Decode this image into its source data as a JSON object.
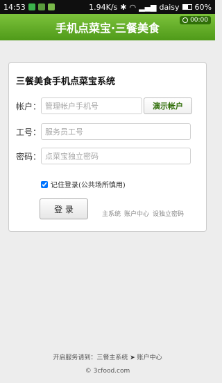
{
  "status_bar": {
    "time": "14:53",
    "speed": "1.94K/s",
    "carrier": "daisy",
    "battery": "60%",
    "battery_level": 0.6
  },
  "header": {
    "title": "手机点菜宝·三餐美食",
    "timer": "00:00"
  },
  "login": {
    "title": "三餐美食手机点菜宝系统",
    "account_label": "帐户：",
    "account_placeholder": "管理帐户手机号",
    "demo_button": "演示帐户",
    "staff_label": "工号：",
    "staff_placeholder": "服务员工号",
    "password_label": "密码：",
    "password_placeholder": "点菜宝独立密码",
    "remember_label": "记住登录(公共场所慎用)",
    "remember_checked": true,
    "login_button": "登 录",
    "links": [
      "主系统",
      "账户中心",
      "设独立密码"
    ]
  },
  "footer": {
    "service_prefix": "开启服务请到：三餐主系统",
    "arrow": "➤",
    "service_target": "账户中心",
    "copyright": "© 3cfood.com"
  }
}
